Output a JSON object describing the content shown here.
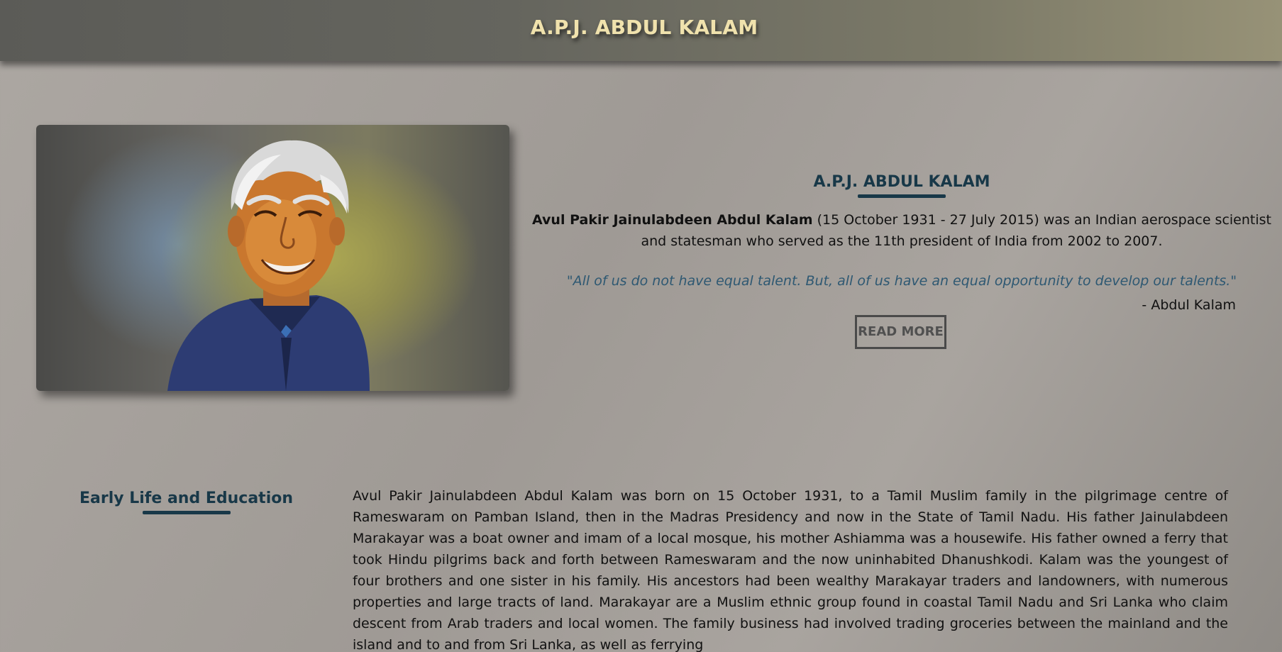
{
  "header": {
    "title": "A.P.J. ABDUL KALAM"
  },
  "hero": {
    "image_name": "abdul-kalam-portrait",
    "heading": "A.P.J. ABDUL KALAM",
    "name_bold": "Avul Pakir Jainulabdeen Abdul Kalam",
    "intro_rest": " (15 October 1931 - 27 July 2015) was an Indian aerospace scientist and statesman who served as the 11th president of India from 2002 to 2007.",
    "quote": "\"All of us do not have equal talent. But, all of us have an equal opportunity to develop our talents.\"",
    "quote_author": "- Abdul Kalam",
    "read_more_label": "READ MORE"
  },
  "early_life": {
    "heading": "Early Life and Education",
    "text": "Avul Pakir Jainulabdeen Abdul Kalam was born on 15 October 1931, to a Tamil Muslim family in the pilgrimage centre of Rameswaram on Pamban Island, then in the Madras Presidency and now in the State of Tamil Nadu. His father Jainulabdeen Marakayar was a boat owner and imam of a local mosque, his mother Ashiamma was a housewife. His father owned a ferry that took Hindu pilgrims back and forth between Rameswaram and the now uninhabited Dhanushkodi. Kalam was the youngest of four brothers and one sister in his family. His ancestors had been wealthy Marakayar traders and landowners, with numerous properties and large tracts of land. Marakayar are a Muslim ethnic group found in coastal Tamil Nadu and Sri Lanka who claim descent from Arab traders and local women. The family business had involved trading groceries between the mainland and the island and to and from Sri Lanka, as well as ferrying"
  },
  "colors": {
    "header_title": "#f0e2ad",
    "heading": "#183848",
    "quote": "#2e5872"
  }
}
